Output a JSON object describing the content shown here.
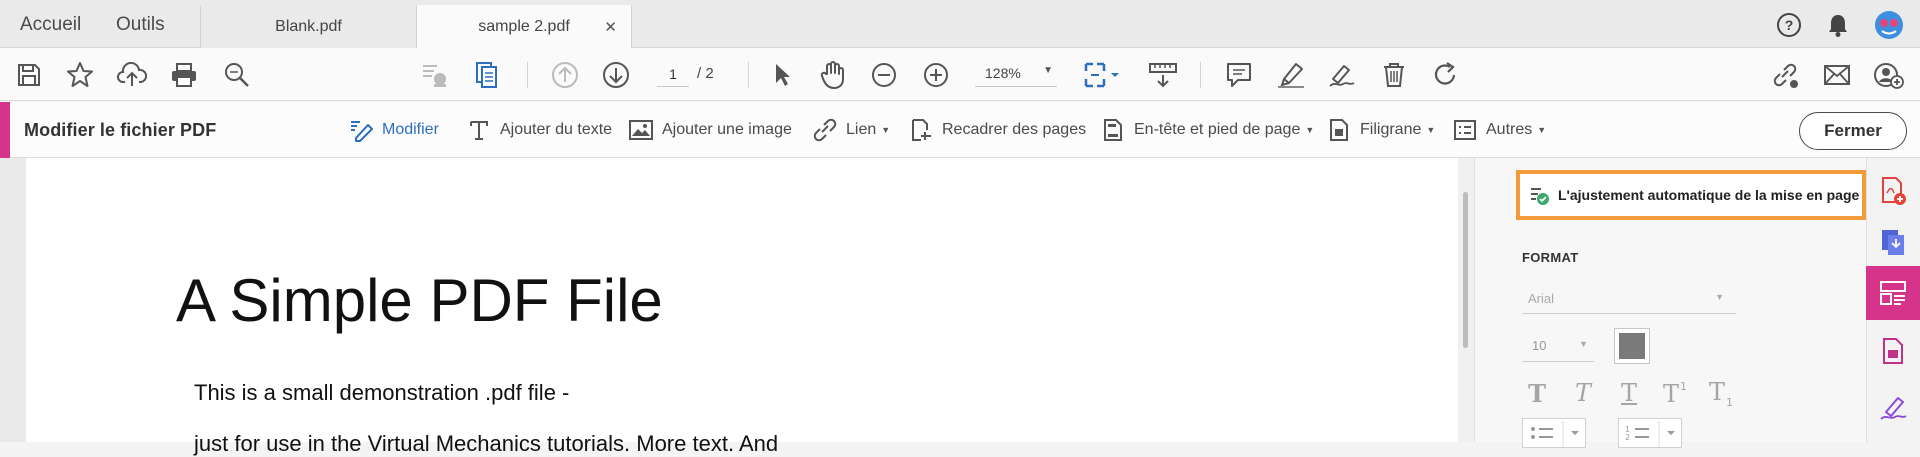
{
  "tabbar": {
    "home": "Accueil",
    "tools": "Outils",
    "tabs": [
      {
        "label": "Blank.pdf"
      },
      {
        "label": "sample 2.pdf"
      }
    ],
    "close_glyph": "✕"
  },
  "toolbar": {
    "page_current": "1",
    "page_total": "/ 2",
    "zoom": "128%"
  },
  "edit_bar": {
    "title": "Modifier le fichier PDF",
    "tools": {
      "edit": "Modifier",
      "add_text": "Ajouter du texte",
      "add_image": "Ajouter une image",
      "link": "Lien",
      "crop": "Recadrer des pages",
      "header_footer": "En-tête et pied de page",
      "watermark": "Filigrane",
      "more": "Autres"
    },
    "close": "Fermer"
  },
  "document": {
    "title": "A Simple PDF File",
    "line1": "This is a small demonstration .pdf file -",
    "line2": "just for use in the Virtual Mechanics tutorials. More text. And"
  },
  "panel": {
    "autofit": "L'ajustement automatique de la mise en page",
    "format_label": "FORMAT",
    "font": "Arial",
    "size": "10"
  },
  "colors": {
    "accent": "#d6338a",
    "active_blue": "#2c6fc0",
    "highlight": "#f39a3a"
  }
}
